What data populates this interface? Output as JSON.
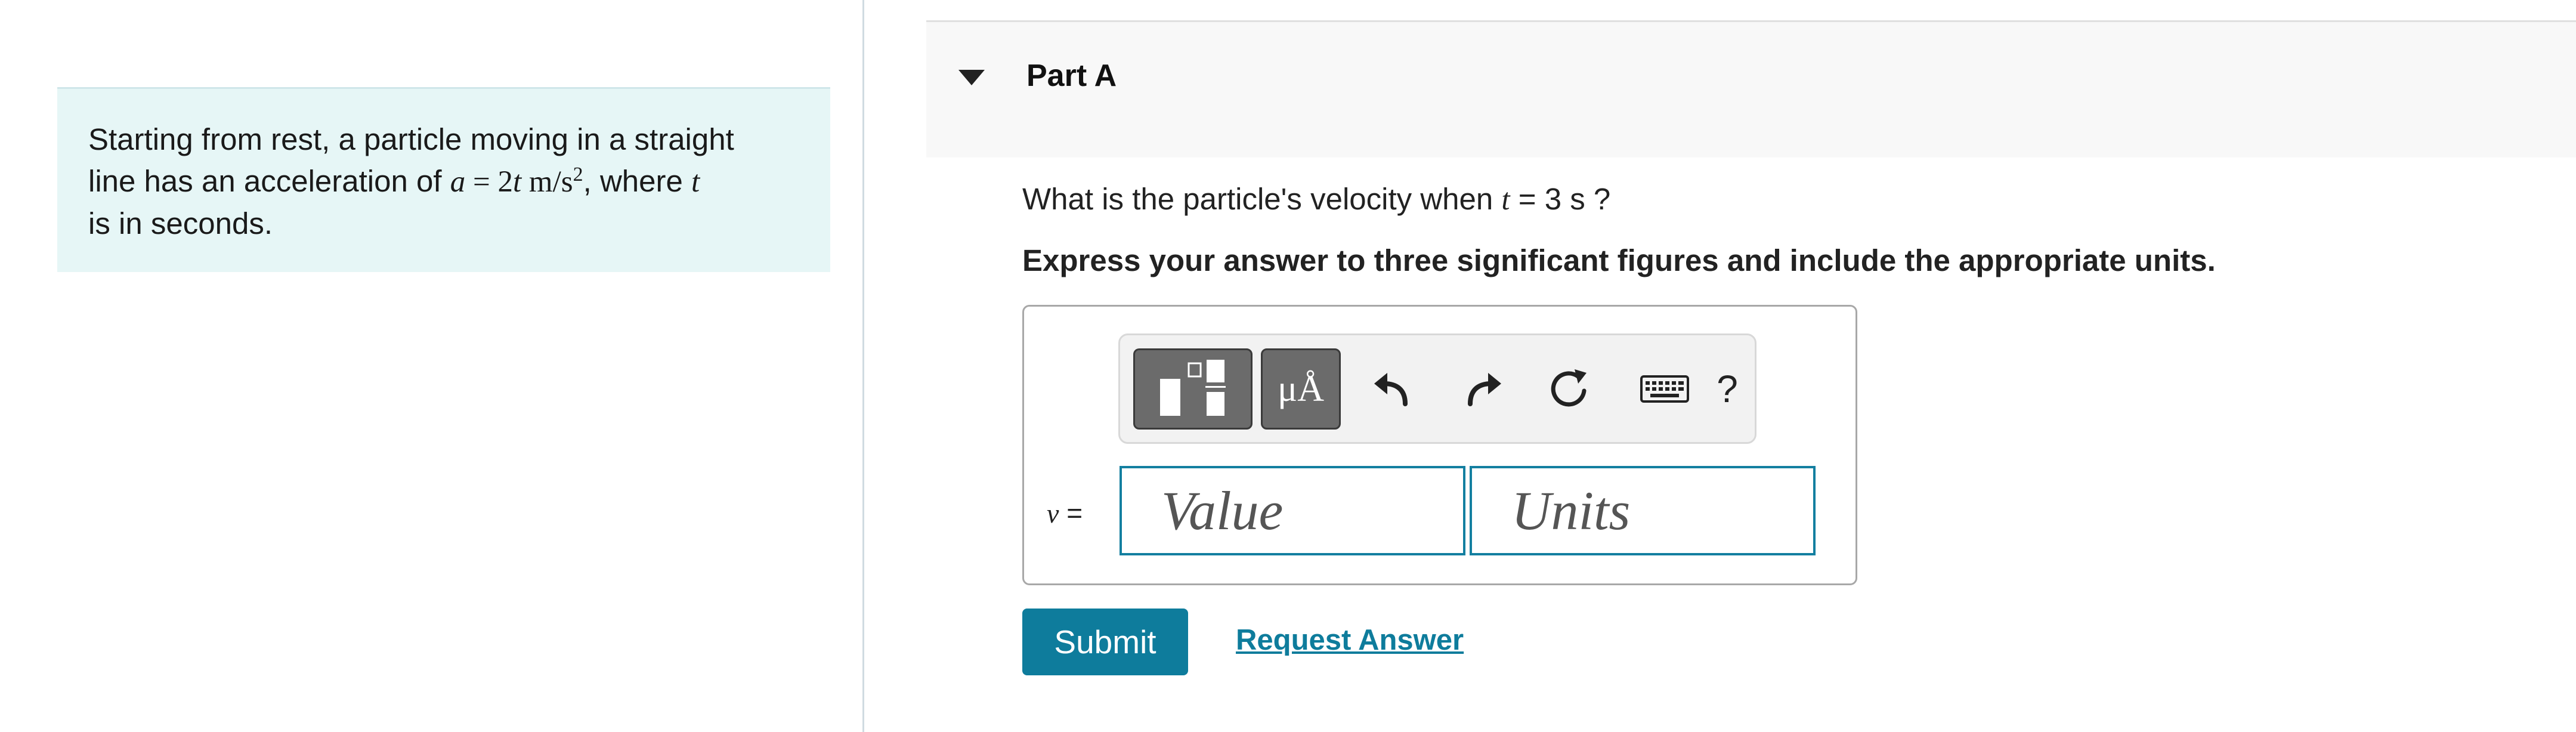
{
  "problem": {
    "line1": "Starting from rest, a particle moving in a straight",
    "line2_pre": "line has an acceleration of ",
    "var_a": "a",
    "eq": " = ",
    "coef": "2",
    "var_t": "t",
    "unit_m": " m/s",
    "unit_exp": "2",
    "line2_post": ", where ",
    "line3": "is in seconds."
  },
  "part": {
    "title": "Part A"
  },
  "question": {
    "prefix": "What is the particle's velocity when ",
    "var": "t",
    "middle": " = 3  s ?"
  },
  "instruction": "Express your answer to three significant figures and include the appropriate units.",
  "toolbar": {
    "templates_icon": "templates-icon",
    "units_label": "μÅ",
    "undo_icon": "undo-icon",
    "redo_icon": "redo-icon",
    "reset_icon": "reset-icon",
    "keyboard_icon": "keyboard-icon",
    "help_label": "?"
  },
  "answer": {
    "var": "v",
    "eq": " =",
    "value_placeholder": "Value",
    "units_placeholder": "Units"
  },
  "actions": {
    "submit_label": "Submit",
    "request_label": "Request Answer"
  },
  "colors": {
    "accent": "#0e7c9c",
    "problem_bg": "#e6f6f6",
    "header_bg": "#f8f8f8"
  }
}
